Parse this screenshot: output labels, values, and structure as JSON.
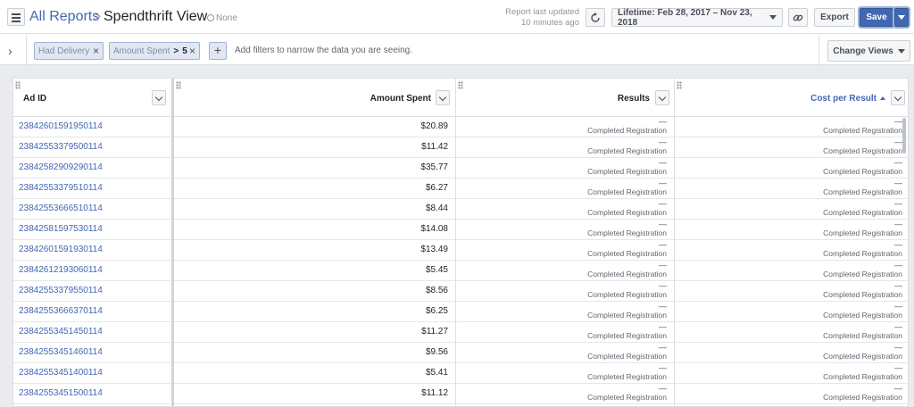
{
  "header": {
    "menu_icon": "hamburger-icon",
    "breadcrumb_link": "All Reports",
    "breadcrumb_sep": ">",
    "title": "Spendthrift View",
    "tag": "None",
    "report_updated_line1": "Report last updated",
    "report_updated_line2": "10 minutes ago",
    "date_range": "Lifetime: Feb 28, 2017 – Nov 23, 2018",
    "export_label": "Export",
    "save_label": "Save",
    "accent_color": "#4267b2"
  },
  "filters": {
    "chips": [
      {
        "label": "Had Delivery"
      },
      {
        "label": "Amount Spent",
        "operator": ">",
        "value": "5"
      }
    ],
    "hint": "Add filters to narrow the data you are seeing.",
    "change_views_label": "Change Views"
  },
  "table": {
    "columns": [
      {
        "label": "Ad ID"
      },
      {
        "label": "Amount Spent"
      },
      {
        "label": "Results"
      },
      {
        "label": "Cost per Result",
        "sorted": "ascending"
      }
    ],
    "result_type": "Completed Registration",
    "result_dash": "—",
    "rows": [
      {
        "ad_id": "23842601591950114",
        "amount": "$20.89"
      },
      {
        "ad_id": "23842553379500114",
        "amount": "$11.42"
      },
      {
        "ad_id": "23842582909290114",
        "amount": "$35.77"
      },
      {
        "ad_id": "23842553379510114",
        "amount": "$6.27"
      },
      {
        "ad_id": "23842553666510114",
        "amount": "$8.44"
      },
      {
        "ad_id": "23842581597530114",
        "amount": "$14.08"
      },
      {
        "ad_id": "23842601591930114",
        "amount": "$13.49"
      },
      {
        "ad_id": "23842612193060114",
        "amount": "$5.45"
      },
      {
        "ad_id": "23842553379550114",
        "amount": "$8.56"
      },
      {
        "ad_id": "23842553666370114",
        "amount": "$6.25"
      },
      {
        "ad_id": "23842553451450114",
        "amount": "$11.27"
      },
      {
        "ad_id": "23842553451460114",
        "amount": "$9.56"
      },
      {
        "ad_id": "23842553451400114",
        "amount": "$5.41"
      },
      {
        "ad_id": "23842553451500114",
        "amount": "$11.12"
      }
    ]
  }
}
